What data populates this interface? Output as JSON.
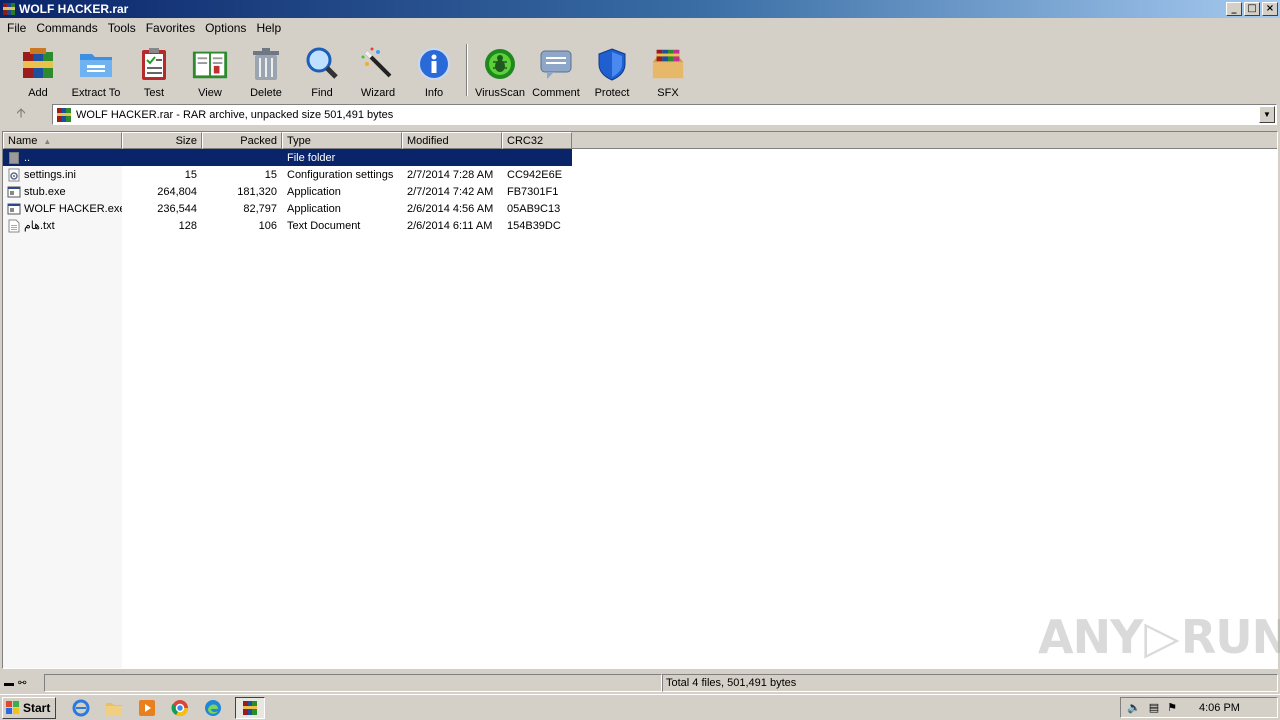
{
  "window": {
    "title": "WOLF HACKER.rar",
    "min": "_",
    "max": "□",
    "close": "×"
  },
  "menu": [
    "File",
    "Commands",
    "Tools",
    "Favorites",
    "Options",
    "Help"
  ],
  "toolbar": [
    {
      "label": "Add",
      "icon": "add-archive-icon"
    },
    {
      "label": "Extract To",
      "icon": "extract-folder-icon"
    },
    {
      "label": "Test",
      "icon": "test-clipboard-icon"
    },
    {
      "label": "View",
      "icon": "view-book-icon"
    },
    {
      "label": "Delete",
      "icon": "trash-icon"
    },
    {
      "label": "Find",
      "icon": "magnifier-icon"
    },
    {
      "label": "Wizard",
      "icon": "magic-wand-icon"
    },
    {
      "label": "Info",
      "icon": "info-icon"
    },
    {
      "label": "VirusScan",
      "icon": "bug-icon"
    },
    {
      "label": "Comment",
      "icon": "comment-icon"
    },
    {
      "label": "Protect",
      "icon": "shield-icon"
    },
    {
      "label": "SFX",
      "icon": "sfx-box-icon"
    }
  ],
  "address": {
    "text": "WOLF HACKER.rar - RAR archive, unpacked size 501,491 bytes"
  },
  "columns": {
    "name": "Name",
    "size": "Size",
    "packed": "Packed",
    "type": "Type",
    "modified": "Modified",
    "crc": "CRC32"
  },
  "rows": [
    {
      "name": "..",
      "size": "",
      "packed": "",
      "type": "File folder",
      "modified": "",
      "crc": "",
      "icon": "folder-icon",
      "selected": true
    },
    {
      "name": "settings.ini",
      "size": "15",
      "packed": "15",
      "type": "Configuration settings",
      "modified": "2/7/2014 7:28 AM",
      "crc": "CC942E6E",
      "icon": "ini-file-icon"
    },
    {
      "name": "stub.exe",
      "size": "264,804",
      "packed": "181,320",
      "type": "Application",
      "modified": "2/7/2014 7:42 AM",
      "crc": "FB7301F1",
      "icon": "exe-file-icon"
    },
    {
      "name": "WOLF HACKER.exe",
      "size": "236,544",
      "packed": "82,797",
      "type": "Application",
      "modified": "2/6/2014 4:56 AM",
      "crc": "05AB9C13",
      "icon": "exe-file-icon"
    },
    {
      "name": "هام.txt",
      "size": "128",
      "packed": "106",
      "type": "Text Document",
      "modified": "2/6/2014 6:11 AM",
      "crc": "154B39DC",
      "icon": "text-file-icon"
    }
  ],
  "status": {
    "selection": "",
    "total": "Total 4 files, 501,491 bytes"
  },
  "watermark": {
    "left": "ANY",
    "right": "RUN"
  },
  "taskbar": {
    "start": "Start",
    "clock": "4:06 PM"
  }
}
